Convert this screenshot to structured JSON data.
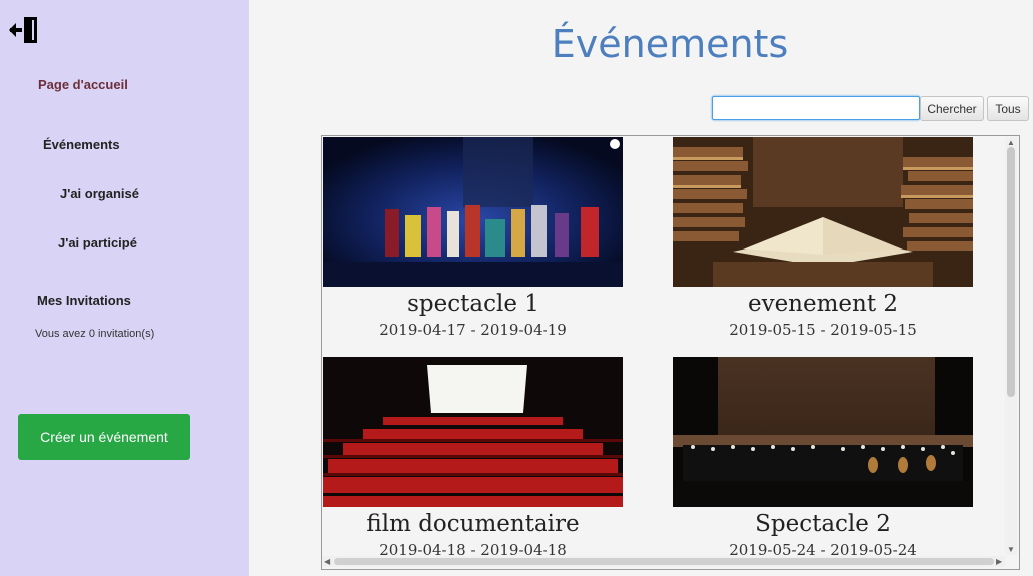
{
  "sidebar": {
    "home": "Page d'accueil",
    "events": "Événements",
    "organized": "J'ai organisé",
    "participated": "J'ai participé",
    "invitations": "Mes Invitations",
    "invitation_count": "Vous avez 0 invitation(s)",
    "create_button": "Créer un événement"
  },
  "main": {
    "title": "Événements",
    "search": {
      "value": "",
      "button": "Chercher",
      "all_button": "Tous"
    },
    "events": [
      {
        "name": "spectacle 1",
        "dates": "2019-04-17 - 2019-04-19"
      },
      {
        "name": "evenement 2",
        "dates": "2019-05-15 - 2019-05-15"
      },
      {
        "name": "film documentaire",
        "dates": "2019-04-18 - 2019-04-18"
      },
      {
        "name": "Spectacle 2",
        "dates": "2019-05-24 - 2019-05-24"
      }
    ]
  },
  "colors": {
    "sidebar_bg": "#d9d3f5",
    "title": "#4d7fbe",
    "create_button": "#28a745",
    "home_link": "#6b2f3a"
  }
}
